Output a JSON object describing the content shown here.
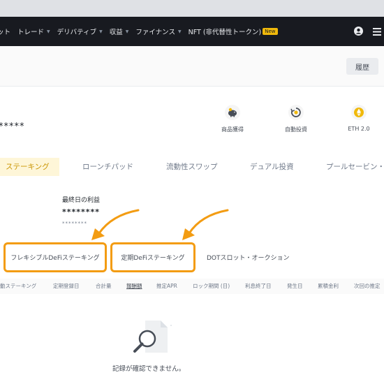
{
  "nav": {
    "items": [
      {
        "label": "ット",
        "caret": false
      },
      {
        "label": "トレード",
        "caret": true
      },
      {
        "label": "デリバティブ",
        "caret": true
      },
      {
        "label": "収益",
        "caret": true
      },
      {
        "label": "ファイナンス",
        "caret": true
      },
      {
        "label": "NFT (非代替性トークン)",
        "caret": false
      }
    ],
    "new_badge": "New",
    "caret_glyph": "▼",
    "user_icon": "user-icon",
    "menu_icon": "menu-icon"
  },
  "header": {
    "history_label": "履歴"
  },
  "balance": {
    "masked": "*****"
  },
  "quick_actions": [
    {
      "label": "商品獲得",
      "icon": "piggy-bank-icon"
    },
    {
      "label": "自動投資",
      "icon": "auto-invest-icon"
    },
    {
      "label": "ETH 2.0",
      "icon": "ethereum-icon"
    }
  ],
  "tabs": [
    {
      "label": "ステーキング",
      "active": true
    },
    {
      "label": "ローンチパッド",
      "active": false
    },
    {
      "label": "流動性スワップ",
      "active": false
    },
    {
      "label": "デュアル投資",
      "active": false
    },
    {
      "label": "プールセービン・",
      "active": false
    }
  ],
  "last_day": {
    "title": "最終日の利益",
    "value": "********",
    "sub": "********"
  },
  "subtabs": [
    {
      "label": "フレキシブルDeFiステーキング",
      "boxed": true
    },
    {
      "label": "定期DeFiステーキング",
      "boxed": true
    },
    {
      "label": "DOTスロット・オークション",
      "boxed": false
    }
  ],
  "table": {
    "headers": [
      "動ステーキング",
      "定期登録日",
      "合計量",
      "報酬額",
      "推定APR",
      "ロック期間 (日)",
      "利息終了日",
      "発生日",
      "累積金利",
      "次回の推定"
    ]
  },
  "empty": {
    "message": "記録が確認できません。",
    "icon": "search-document-icon"
  },
  "colors": {
    "accent": "#f39c12",
    "brand_yellow": "#f0b90b",
    "navbar": "#181a20",
    "active_tab_bg": "#fef6d8",
    "active_tab_text": "#c99400"
  }
}
